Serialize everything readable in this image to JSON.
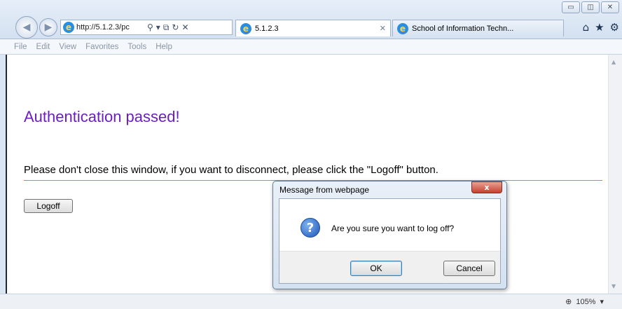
{
  "browser": {
    "address_url": "http://5.1.2.3/pc",
    "tabs": [
      {
        "label": "5.1.2.3",
        "active": true
      },
      {
        "label": "School of Information Techn...",
        "active": false
      }
    ],
    "menu": [
      "File",
      "Edit",
      "View",
      "Favorites",
      "Tools",
      "Help"
    ],
    "status_zoom": "105%"
  },
  "page": {
    "heading": "Authentication passed!",
    "instruction": "Please don't close this window, if you want to disconnect, please click the \"Logoff\" button.",
    "logoff_label": "Logoff",
    "heading_color": "#6c1fbf",
    "rule_color": "#38b6d8"
  },
  "dialog": {
    "title": "Message from webpage",
    "message": "Are you sure you want to log off?",
    "ok_label": "OK",
    "cancel_label": "Cancel",
    "close_glyph": "x",
    "icon": "question-icon"
  },
  "icons": {
    "minimize": "minimize-icon",
    "restore": "restore-icon",
    "close": "close-icon",
    "home": "home-icon",
    "favorites": "star-icon",
    "tools": "gear-icon"
  }
}
